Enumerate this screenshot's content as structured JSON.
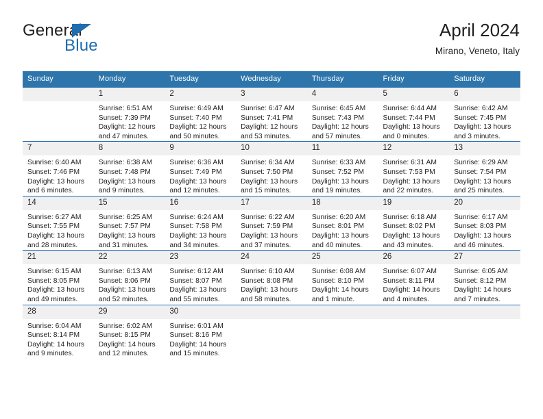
{
  "brand": {
    "name_top": "General",
    "name_bottom": "Blue",
    "accent_color": "#1f6cb0"
  },
  "header": {
    "title": "April 2024",
    "subtitle": "Mirano, Veneto, Italy"
  },
  "calendar": {
    "header_bg": "#2e75ab",
    "daynum_bg": "#f0f0f0",
    "grid_line_color": "#1f6cb0",
    "weekday_headers": [
      "Sunday",
      "Monday",
      "Tuesday",
      "Wednesday",
      "Thursday",
      "Friday",
      "Saturday"
    ],
    "weeks": [
      [
        {
          "day": "",
          "sunrise": "",
          "sunset": "",
          "daylight": ""
        },
        {
          "day": "1",
          "sunrise": "Sunrise: 6:51 AM",
          "sunset": "Sunset: 7:39 PM",
          "daylight": "Daylight: 12 hours and 47 minutes."
        },
        {
          "day": "2",
          "sunrise": "Sunrise: 6:49 AM",
          "sunset": "Sunset: 7:40 PM",
          "daylight": "Daylight: 12 hours and 50 minutes."
        },
        {
          "day": "3",
          "sunrise": "Sunrise: 6:47 AM",
          "sunset": "Sunset: 7:41 PM",
          "daylight": "Daylight: 12 hours and 53 minutes."
        },
        {
          "day": "4",
          "sunrise": "Sunrise: 6:45 AM",
          "sunset": "Sunset: 7:43 PM",
          "daylight": "Daylight: 12 hours and 57 minutes."
        },
        {
          "day": "5",
          "sunrise": "Sunrise: 6:44 AM",
          "sunset": "Sunset: 7:44 PM",
          "daylight": "Daylight: 13 hours and 0 minutes."
        },
        {
          "day": "6",
          "sunrise": "Sunrise: 6:42 AM",
          "sunset": "Sunset: 7:45 PM",
          "daylight": "Daylight: 13 hours and 3 minutes."
        }
      ],
      [
        {
          "day": "7",
          "sunrise": "Sunrise: 6:40 AM",
          "sunset": "Sunset: 7:46 PM",
          "daylight": "Daylight: 13 hours and 6 minutes."
        },
        {
          "day": "8",
          "sunrise": "Sunrise: 6:38 AM",
          "sunset": "Sunset: 7:48 PM",
          "daylight": "Daylight: 13 hours and 9 minutes."
        },
        {
          "day": "9",
          "sunrise": "Sunrise: 6:36 AM",
          "sunset": "Sunset: 7:49 PM",
          "daylight": "Daylight: 13 hours and 12 minutes."
        },
        {
          "day": "10",
          "sunrise": "Sunrise: 6:34 AM",
          "sunset": "Sunset: 7:50 PM",
          "daylight": "Daylight: 13 hours and 15 minutes."
        },
        {
          "day": "11",
          "sunrise": "Sunrise: 6:33 AM",
          "sunset": "Sunset: 7:52 PM",
          "daylight": "Daylight: 13 hours and 19 minutes."
        },
        {
          "day": "12",
          "sunrise": "Sunrise: 6:31 AM",
          "sunset": "Sunset: 7:53 PM",
          "daylight": "Daylight: 13 hours and 22 minutes."
        },
        {
          "day": "13",
          "sunrise": "Sunrise: 6:29 AM",
          "sunset": "Sunset: 7:54 PM",
          "daylight": "Daylight: 13 hours and 25 minutes."
        }
      ],
      [
        {
          "day": "14",
          "sunrise": "Sunrise: 6:27 AM",
          "sunset": "Sunset: 7:55 PM",
          "daylight": "Daylight: 13 hours and 28 minutes."
        },
        {
          "day": "15",
          "sunrise": "Sunrise: 6:25 AM",
          "sunset": "Sunset: 7:57 PM",
          "daylight": "Daylight: 13 hours and 31 minutes."
        },
        {
          "day": "16",
          "sunrise": "Sunrise: 6:24 AM",
          "sunset": "Sunset: 7:58 PM",
          "daylight": "Daylight: 13 hours and 34 minutes."
        },
        {
          "day": "17",
          "sunrise": "Sunrise: 6:22 AM",
          "sunset": "Sunset: 7:59 PM",
          "daylight": "Daylight: 13 hours and 37 minutes."
        },
        {
          "day": "18",
          "sunrise": "Sunrise: 6:20 AM",
          "sunset": "Sunset: 8:01 PM",
          "daylight": "Daylight: 13 hours and 40 minutes."
        },
        {
          "day": "19",
          "sunrise": "Sunrise: 6:18 AM",
          "sunset": "Sunset: 8:02 PM",
          "daylight": "Daylight: 13 hours and 43 minutes."
        },
        {
          "day": "20",
          "sunrise": "Sunrise: 6:17 AM",
          "sunset": "Sunset: 8:03 PM",
          "daylight": "Daylight: 13 hours and 46 minutes."
        }
      ],
      [
        {
          "day": "21",
          "sunrise": "Sunrise: 6:15 AM",
          "sunset": "Sunset: 8:05 PM",
          "daylight": "Daylight: 13 hours and 49 minutes."
        },
        {
          "day": "22",
          "sunrise": "Sunrise: 6:13 AM",
          "sunset": "Sunset: 8:06 PM",
          "daylight": "Daylight: 13 hours and 52 minutes."
        },
        {
          "day": "23",
          "sunrise": "Sunrise: 6:12 AM",
          "sunset": "Sunset: 8:07 PM",
          "daylight": "Daylight: 13 hours and 55 minutes."
        },
        {
          "day": "24",
          "sunrise": "Sunrise: 6:10 AM",
          "sunset": "Sunset: 8:08 PM",
          "daylight": "Daylight: 13 hours and 58 minutes."
        },
        {
          "day": "25",
          "sunrise": "Sunrise: 6:08 AM",
          "sunset": "Sunset: 8:10 PM",
          "daylight": "Daylight: 14 hours and 1 minute."
        },
        {
          "day": "26",
          "sunrise": "Sunrise: 6:07 AM",
          "sunset": "Sunset: 8:11 PM",
          "daylight": "Daylight: 14 hours and 4 minutes."
        },
        {
          "day": "27",
          "sunrise": "Sunrise: 6:05 AM",
          "sunset": "Sunset: 8:12 PM",
          "daylight": "Daylight: 14 hours and 7 minutes."
        }
      ],
      [
        {
          "day": "28",
          "sunrise": "Sunrise: 6:04 AM",
          "sunset": "Sunset: 8:14 PM",
          "daylight": "Daylight: 14 hours and 9 minutes."
        },
        {
          "day": "29",
          "sunrise": "Sunrise: 6:02 AM",
          "sunset": "Sunset: 8:15 PM",
          "daylight": "Daylight: 14 hours and 12 minutes."
        },
        {
          "day": "30",
          "sunrise": "Sunrise: 6:01 AM",
          "sunset": "Sunset: 8:16 PM",
          "daylight": "Daylight: 14 hours and 15 minutes."
        },
        {
          "day": "",
          "sunrise": "",
          "sunset": "",
          "daylight": ""
        },
        {
          "day": "",
          "sunrise": "",
          "sunset": "",
          "daylight": ""
        },
        {
          "day": "",
          "sunrise": "",
          "sunset": "",
          "daylight": ""
        },
        {
          "day": "",
          "sunrise": "",
          "sunset": "",
          "daylight": ""
        }
      ]
    ]
  }
}
